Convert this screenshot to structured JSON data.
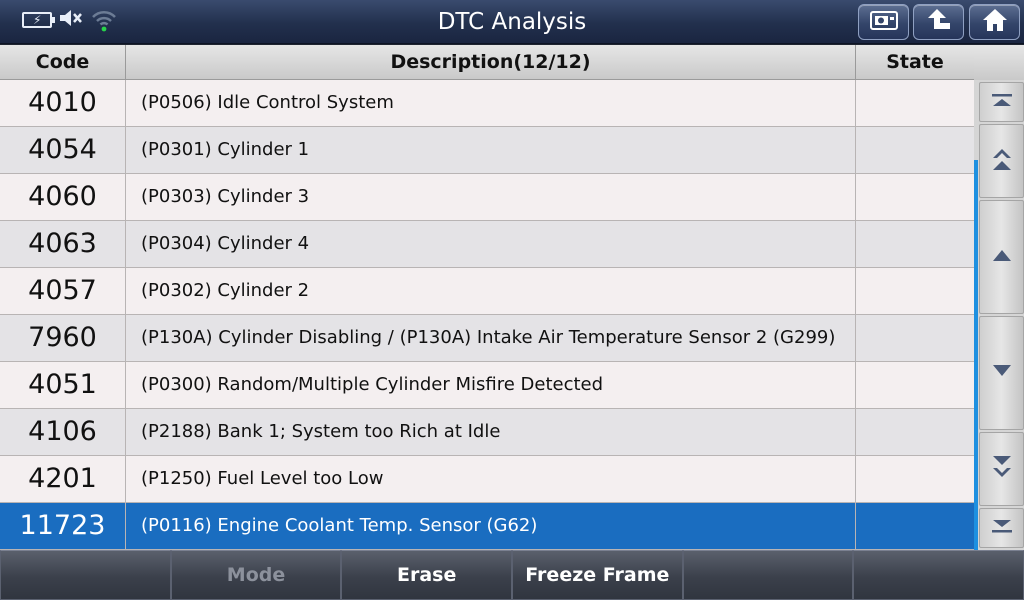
{
  "header": {
    "title": "DTC Analysis"
  },
  "table": {
    "columns": {
      "code": "Code",
      "description": "Description(12/12)",
      "state": "State"
    },
    "rows": [
      {
        "code": "4010",
        "description": "(P0506) Idle Control System",
        "state": ""
      },
      {
        "code": "4054",
        "description": "(P0301) Cylinder 1",
        "state": ""
      },
      {
        "code": "4060",
        "description": "(P0303) Cylinder 3",
        "state": ""
      },
      {
        "code": "4063",
        "description": "(P0304) Cylinder 4",
        "state": ""
      },
      {
        "code": "4057",
        "description": "(P0302) Cylinder 2",
        "state": ""
      },
      {
        "code": "7960",
        "description": "(P130A) Cylinder Disabling / (P130A) Intake Air Temperature Sensor 2 (G299)",
        "state": ""
      },
      {
        "code": "4051",
        "description": "(P0300) Random/Multiple Cylinder Misfire Detected",
        "state": ""
      },
      {
        "code": "4106",
        "description": "(P2188) Bank 1; System too Rich at Idle",
        "state": ""
      },
      {
        "code": "4201",
        "description": "(P1250) Fuel Level too Low",
        "state": ""
      },
      {
        "code": "11723",
        "description": "(P0116) Engine Coolant Temp. Sensor (G62)",
        "state": ""
      }
    ],
    "selected_index": 9
  },
  "footer": {
    "buttons": [
      "",
      "Mode",
      "Erase",
      "Freeze Frame",
      "",
      ""
    ]
  },
  "colors": {
    "selected_row": "#1a6dc0",
    "scroll_indicator": "#1e90e0"
  },
  "icons": {
    "status": [
      "battery-charging-icon",
      "speaker-mute-icon",
      "wifi-icon"
    ],
    "toolbar": [
      "screenshot-icon",
      "back-arrow-icon",
      "home-icon"
    ],
    "scroll": [
      "scroll-top-icon",
      "page-up-icon",
      "scroll-up-icon",
      "scroll-down-icon",
      "page-down-icon",
      "scroll-bottom-icon"
    ]
  }
}
